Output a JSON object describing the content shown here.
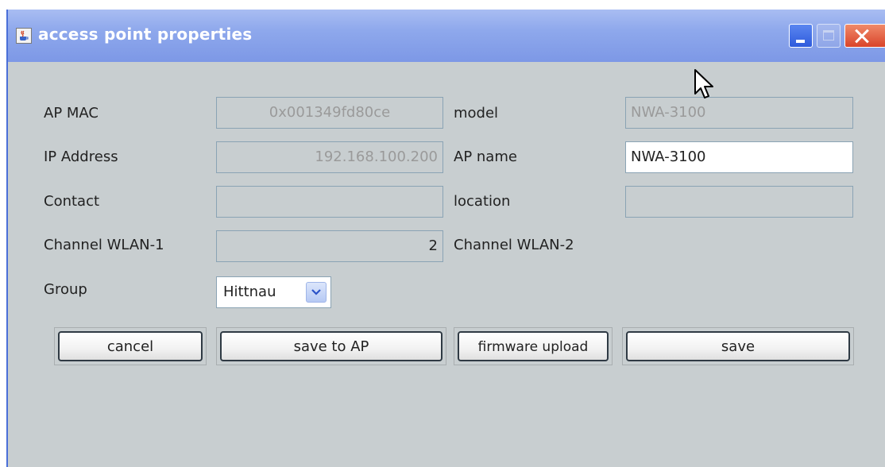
{
  "window": {
    "title": "access point properties",
    "icons": {
      "app": "java-cup-icon",
      "minimize": "minimize-icon",
      "maximize": "maximize-icon",
      "close": "close-icon"
    }
  },
  "form": {
    "ap_mac": {
      "label": "AP MAC",
      "value": "0x001349fd80ce"
    },
    "model": {
      "label": "model",
      "value": "NWA-3100"
    },
    "ip_address": {
      "label": "IP Address",
      "value": "192.168.100.200"
    },
    "ap_name": {
      "label": "AP name",
      "value": "NWA-3100"
    },
    "contact": {
      "label": "Contact",
      "value": ""
    },
    "location": {
      "label": "location",
      "value": ""
    },
    "channel_wlan1": {
      "label": "Channel WLAN-1",
      "value": "2"
    },
    "channel_wlan2": {
      "label": "Channel WLAN-2"
    },
    "group": {
      "label": "Group",
      "selected": "Hittnau"
    }
  },
  "buttons": {
    "cancel": "cancel",
    "save_to_ap": "save to AP",
    "firmware_upload": "firmware upload",
    "save": "save"
  },
  "colors": {
    "titlebar": "#8ea8ec",
    "panel": "#c8ced0",
    "close_button": "#d9442a"
  }
}
